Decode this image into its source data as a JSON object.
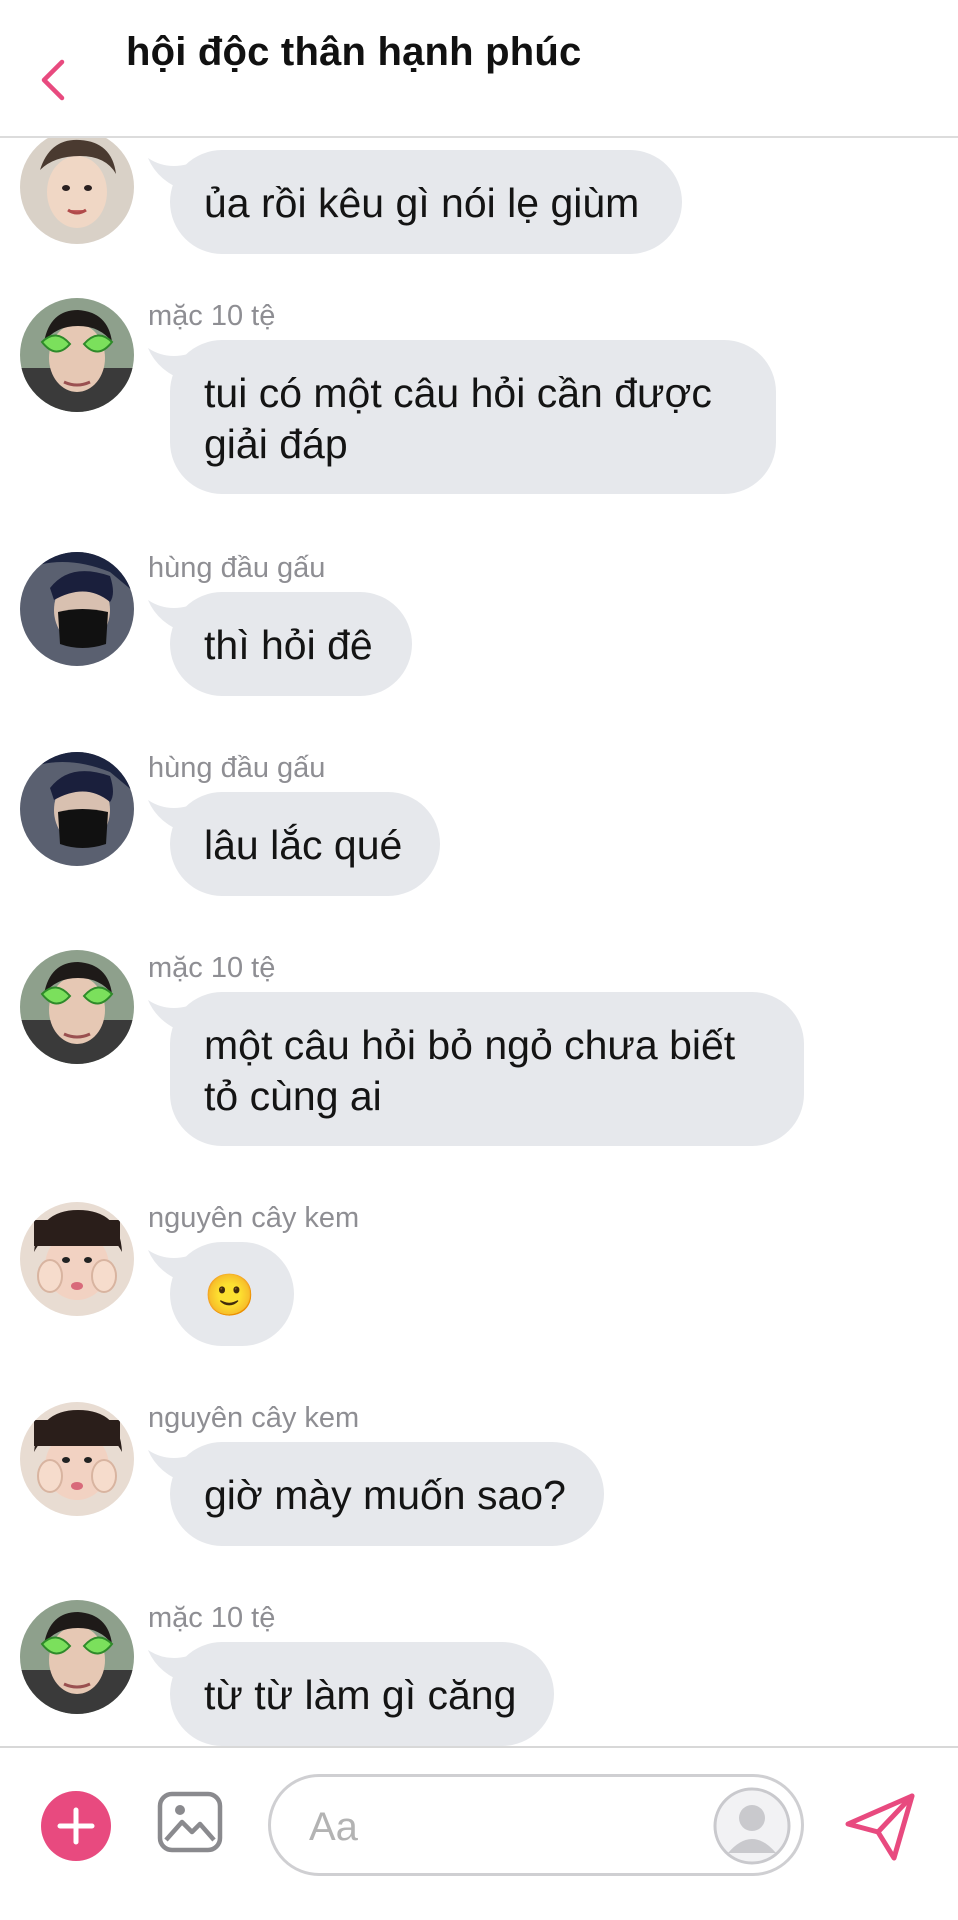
{
  "header": {
    "title": "hội độc thân hạnh phúc",
    "accent_color": "#e84a7f"
  },
  "messages": [
    {
      "sender": "",
      "avatar": "avatar-boy-light",
      "text": "ủa rồi kêu gì nói lẹ giùm"
    },
    {
      "sender": "mặc 10 tệ",
      "avatar": "avatar-green-glasses",
      "text": "tui có một câu hỏi cần được\ngiải đáp"
    },
    {
      "sender": "hùng đầu gấu",
      "avatar": "avatar-masked",
      "text": "thì hỏi đê"
    },
    {
      "sender": "hùng đầu gấu",
      "avatar": "avatar-masked",
      "text": "lâu lắc qué"
    },
    {
      "sender": "mặc 10 tệ",
      "avatar": "avatar-green-glasses",
      "text": "một câu hỏi bỏ ngỏ chưa biết\ntỏ cùng ai"
    },
    {
      "sender": "nguyên cây kem",
      "avatar": "avatar-cheek-squish",
      "text": "🙂"
    },
    {
      "sender": "nguyên cây kem",
      "avatar": "avatar-cheek-squish",
      "text": "giờ mày muốn sao?"
    },
    {
      "sender": "mặc 10 tệ",
      "avatar": "avatar-green-glasses",
      "text": "từ từ làm gì căng"
    }
  ],
  "composer": {
    "placeholder": "Aa",
    "add_icon": "plus-circle-icon",
    "image_icon": "image-icon",
    "sticker_icon": "profile-sticker-icon",
    "send_icon": "send-icon"
  }
}
